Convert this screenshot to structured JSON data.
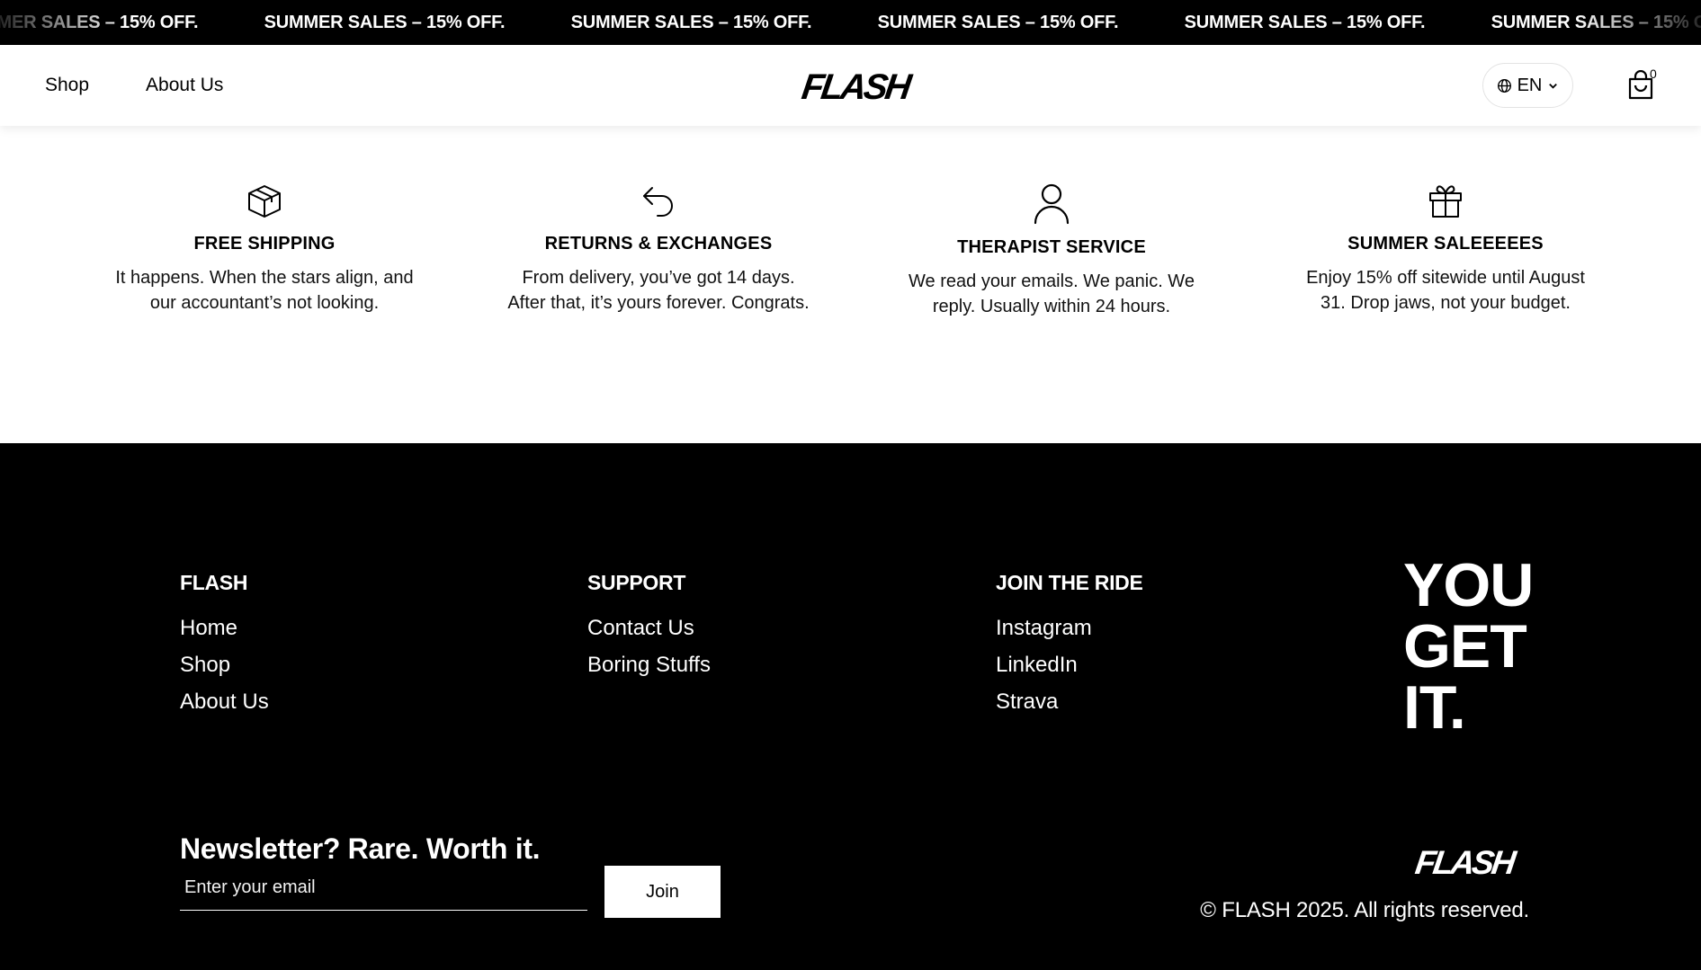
{
  "announcement": {
    "items": [
      "SUMMER SALES – 15% OFF.",
      "SUMMER SALES – 15% OFF.",
      "SUMMER SALES – 15% OFF.",
      "SUMMER SALES – 15% OFF.",
      "SUMMER SALES – 15% OFF.",
      "SUMMER SALES – 15% OFF."
    ]
  },
  "header": {
    "nav": [
      "Shop",
      "About Us"
    ],
    "logo_text": "FLASH",
    "language": "EN",
    "cart_count": "0",
    "icons": {
      "language": "globe-icon",
      "dropdown": "chevron-down-icon",
      "cart": "shopping-bag-icon"
    }
  },
  "features": [
    {
      "icon": "box-icon",
      "title": "FREE SHIPPING",
      "text": "It happens. When the stars align, and our accountant’s not looking."
    },
    {
      "icon": "return-arrow-icon",
      "title": "RETURNS & EXCHANGES",
      "text": "From delivery, you’ve got 14 days. After that, it’s yours forever. Congrats."
    },
    {
      "icon": "user-icon",
      "title": "THERAPIST SERVICE",
      "text": "We read your emails. We panic. We reply. Usually within 24 hours."
    },
    {
      "icon": "gift-icon",
      "title": "SUMMER SALEEEEES",
      "text": "Enjoy 15% off sitewide until August 31. Drop jaws, not your budget."
    }
  ],
  "footer": {
    "columns": [
      {
        "title": "FLASH",
        "links": [
          "Home",
          "Shop",
          "About Us"
        ]
      },
      {
        "title": "SUPPORT",
        "links": [
          "Contact Us",
          "Boring Stuffs"
        ]
      },
      {
        "title": "JOIN THE RIDE",
        "links": [
          "Instagram",
          "LinkedIn",
          "Strava"
        ]
      }
    ],
    "slogan": [
      "YOU",
      "GET",
      "IT."
    ],
    "newsletter": {
      "title": "Newsletter? Rare. Worth it.",
      "placeholder": "Enter your email",
      "button": "Join"
    },
    "logo_text": "FLASH",
    "copyright": "© FLASH 2025. All rights reserved."
  },
  "colors": {
    "background": "#ffffff",
    "footer": "#000000",
    "text": "#000000",
    "announce_bg": "#000000"
  }
}
